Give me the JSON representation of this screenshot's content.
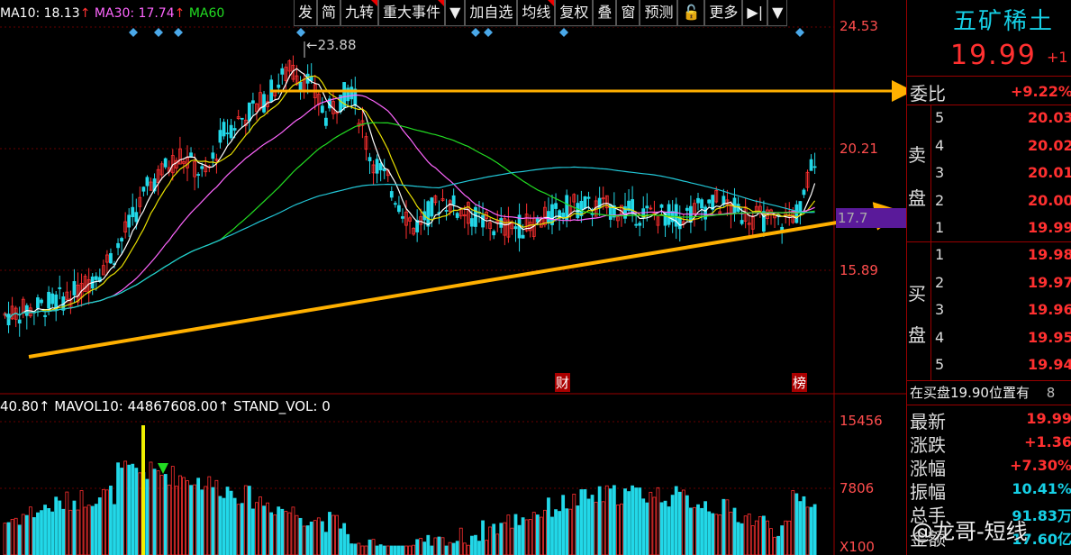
{
  "ma_legend": {
    "ma10": "MA10: 18.13",
    "ma30": "MA30: 17.74",
    "ma60": "MA60",
    "arrow": "↑"
  },
  "toolbar": [
    {
      "label": "发",
      "flag": false
    },
    {
      "label": "简",
      "flag": false
    },
    {
      "label": "九转",
      "flag": true
    },
    {
      "label": "重大事件",
      "flag": true
    },
    {
      "label": "▼",
      "flag": false
    },
    {
      "label": "加自选",
      "flag": false
    },
    {
      "label": "均线",
      "flag": true
    },
    {
      "label": "复权",
      "flag": false
    },
    {
      "label": "叠",
      "flag": false
    },
    {
      "label": "窗",
      "flag": false
    },
    {
      "label": "预测",
      "flag": false
    },
    {
      "label": "🔓",
      "flag": false
    },
    {
      "label": "更多",
      "flag": false
    },
    {
      "label": "▶|",
      "flag": false
    },
    {
      "label": "▼",
      "flag": false
    }
  ],
  "price_axis": [
    "24.53",
    "20.21",
    "15.89",
    "17.7"
  ],
  "high_marker": "←23.88",
  "event_markers": [
    "财",
    "榜"
  ],
  "volume_legend": {
    "vol": "40.80↑",
    "mavol10": "MAVOL10: 44867608.00↑",
    "stand": "STAND_VOL: 0"
  },
  "volume_axis": [
    "15456",
    "7806",
    "X100"
  ],
  "quote": {
    "name": "五矿稀土",
    "price": "19.99",
    "change_short": "+1",
    "webi_label": "委比",
    "webi_value": "+9.22%",
    "sell_label": [
      "卖",
      "盘"
    ],
    "buy_label": [
      "买",
      "盘"
    ],
    "asks": [
      {
        "lvl": "5",
        "price": "20.03"
      },
      {
        "lvl": "4",
        "price": "20.02"
      },
      {
        "lvl": "3",
        "price": "20.01"
      },
      {
        "lvl": "2",
        "price": "20.00"
      },
      {
        "lvl": "1",
        "price": "19.99"
      }
    ],
    "bids": [
      {
        "lvl": "1",
        "price": "19.98"
      },
      {
        "lvl": "2",
        "price": "19.97"
      },
      {
        "lvl": "3",
        "price": "19.96"
      },
      {
        "lvl": "4",
        "price": "19.95"
      },
      {
        "lvl": "5",
        "price": "19.94"
      }
    ],
    "notice": "在买盘19.90位置有",
    "notice_tail": "8",
    "stats": [
      {
        "label": "最新",
        "value": "19.99",
        "color": "red"
      },
      {
        "label": "涨跌",
        "value": "+1.36",
        "color": "red"
      },
      {
        "label": "涨幅",
        "value": "+7.30%",
        "color": "red"
      },
      {
        "label": "振幅",
        "value": "10.41%",
        "color": "cyan"
      },
      {
        "label": "总手",
        "value": "91.83万",
        "color": "cyan"
      },
      {
        "label": "金额",
        "value": "17.60亿",
        "color": "cyan"
      }
    ]
  },
  "watermark": "@龙哥-短线",
  "colors": {
    "up": "#ff3030",
    "down": "#22d8e8",
    "ma5": "#ffffff",
    "ma10": "#e8e000",
    "ma30": "#ff66ff",
    "ma60": "#22dd22",
    "ma120": "#22c8d8",
    "trend": "#ffb000"
  }
}
